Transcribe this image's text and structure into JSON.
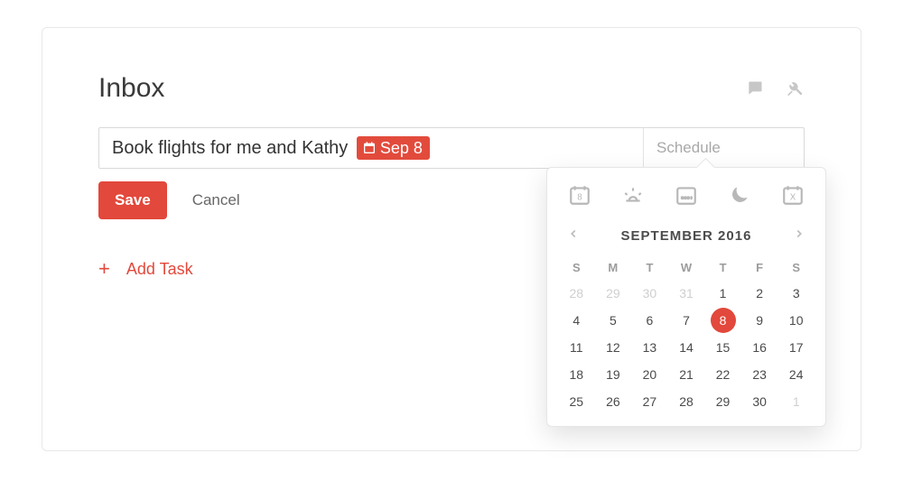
{
  "header": {
    "title": "Inbox"
  },
  "task": {
    "text": "Book flights for me and Kathy ",
    "date_chip": "Sep 8",
    "schedule_placeholder": "Schedule"
  },
  "actions": {
    "save": "Save",
    "cancel": "Cancel",
    "add_task": "Add Task"
  },
  "datepicker": {
    "month_label": "SEPTEMBER 2016",
    "dow": [
      "S",
      "M",
      "T",
      "W",
      "T",
      "F",
      "S"
    ],
    "weeks": [
      [
        {
          "n": "28",
          "muted": true
        },
        {
          "n": "29",
          "muted": true
        },
        {
          "n": "30",
          "muted": true
        },
        {
          "n": "31",
          "muted": true
        },
        {
          "n": "1"
        },
        {
          "n": "2"
        },
        {
          "n": "3"
        }
      ],
      [
        {
          "n": "4"
        },
        {
          "n": "5"
        },
        {
          "n": "6"
        },
        {
          "n": "7"
        },
        {
          "n": "8",
          "selected": true
        },
        {
          "n": "9"
        },
        {
          "n": "10"
        }
      ],
      [
        {
          "n": "11"
        },
        {
          "n": "12"
        },
        {
          "n": "13"
        },
        {
          "n": "14"
        },
        {
          "n": "15"
        },
        {
          "n": "16"
        },
        {
          "n": "17"
        }
      ],
      [
        {
          "n": "18"
        },
        {
          "n": "19"
        },
        {
          "n": "20"
        },
        {
          "n": "21"
        },
        {
          "n": "22"
        },
        {
          "n": "23"
        },
        {
          "n": "24"
        }
      ],
      [
        {
          "n": "25"
        },
        {
          "n": "26"
        },
        {
          "n": "27"
        },
        {
          "n": "28"
        },
        {
          "n": "29"
        },
        {
          "n": "30"
        },
        {
          "n": "1",
          "muted": true
        }
      ]
    ],
    "quick_icons": [
      "today-icon",
      "sunrise-icon",
      "next-week-icon",
      "night-icon",
      "no-date-icon"
    ]
  },
  "colors": {
    "accent": "#e2483b"
  }
}
